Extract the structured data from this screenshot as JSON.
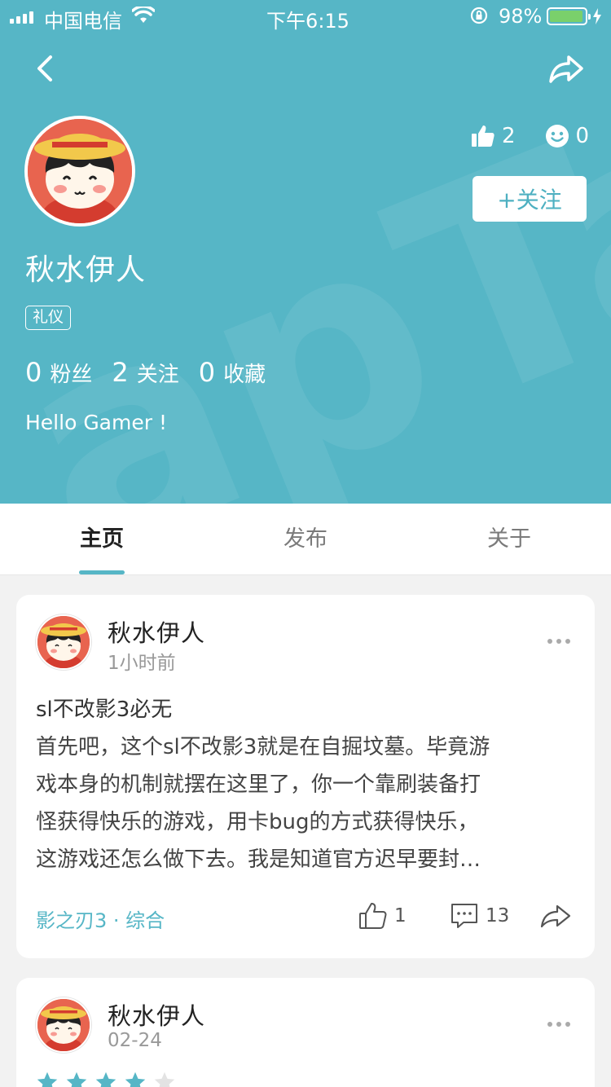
{
  "status_bar": {
    "carrier": "中国电信",
    "time": "下午6:15",
    "battery": "98%"
  },
  "profile": {
    "name": "秋水伊人",
    "tag": "礼仪",
    "likes": "2",
    "emotes": "0",
    "follow_label": "+关注",
    "stats": [
      {
        "num": "0",
        "label": "粉丝"
      },
      {
        "num": "2",
        "label": "关注"
      },
      {
        "num": "0",
        "label": "收藏"
      }
    ],
    "bio": "Hello Gamer !"
  },
  "tabs": [
    {
      "label": "主页"
    },
    {
      "label": "发布"
    },
    {
      "label": "关于"
    }
  ],
  "posts": [
    {
      "author": "秋水伊人",
      "time": "1小时前",
      "title": "sl不改影3必无",
      "body_lines": [
        "首先吧，这个sl不改影3就是在自掘坟墓。毕竟游",
        "戏本身的机制就摆在这里了，你一个靠刷装备打",
        "怪获得快乐的游戏，用卡bug的方式获得快乐，",
        "这游戏还怎么做下去。我是知道官方迟早要封…"
      ],
      "topic": "影之刃3 · 综合",
      "likes": "1",
      "comments": "13"
    },
    {
      "author": "秋水伊人",
      "time": "02-24",
      "rating": 4,
      "rating_max": 5
    }
  ],
  "colors": {
    "accent": "#56b6c6",
    "star_on": "#56b6c6",
    "star_off": "#e3e3e3"
  }
}
